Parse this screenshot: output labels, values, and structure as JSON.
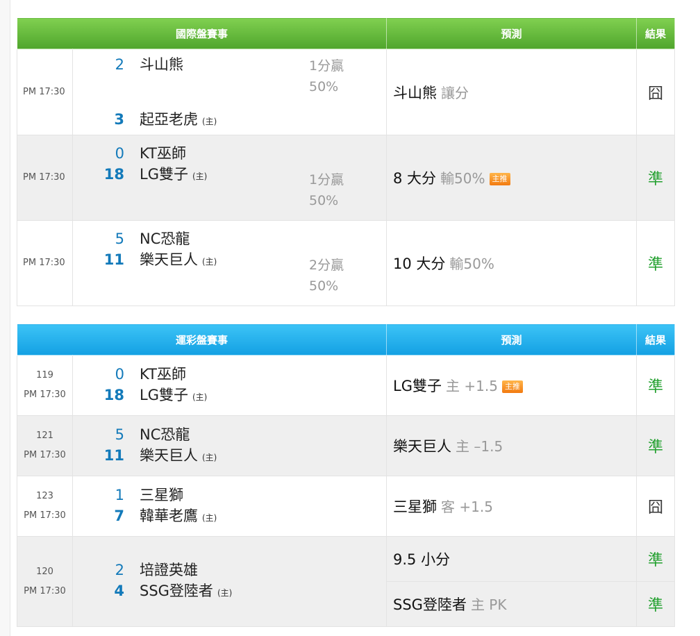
{
  "intl": {
    "headers": {
      "event": "國際盤賽事",
      "predict": "預測",
      "result": "結果"
    },
    "rows": [
      {
        "time": "PM 17:30",
        "away_score": "2",
        "away_team": "斗山熊",
        "home_score": "3",
        "home_team": "起亞老虎",
        "home_tag": "(主)",
        "odds_1": "1分贏",
        "odds_2": "50%",
        "pick": "斗山熊",
        "pick_detail": "讓分",
        "badge": "",
        "result": "囧"
      },
      {
        "time": "PM 17:30",
        "away_score": "0",
        "away_team": "KT巫師",
        "home_score": "18",
        "home_team": "LG雙子",
        "home_tag": "(主)",
        "odds_1": "1分贏",
        "odds_2": "50%",
        "pick": "8 大分",
        "pick_detail": "輸50%",
        "badge": "主推",
        "result": "準"
      },
      {
        "time": "PM 17:30",
        "away_score": "5",
        "away_team": "NC恐龍",
        "home_score": "11",
        "home_team": "樂天巨人",
        "home_tag": "(主)",
        "odds_1": "2分贏",
        "odds_2": "50%",
        "pick": "10 大分",
        "pick_detail": "輸50%",
        "badge": "",
        "result": "準"
      }
    ]
  },
  "lottery": {
    "headers": {
      "event": "運彩盤賽事",
      "predict": "預測",
      "result": "結果"
    },
    "rows": [
      {
        "num": "119",
        "time": "PM 17:30",
        "away_score": "0",
        "away_team": "KT巫師",
        "home_score": "18",
        "home_team": "LG雙子",
        "home_tag": "(主)",
        "pick": "LG雙子",
        "pick_detail": "主 +1.5",
        "badge": "主推",
        "result": "準"
      },
      {
        "num": "121",
        "time": "PM 17:30",
        "away_score": "5",
        "away_team": "NC恐龍",
        "home_score": "11",
        "home_team": "樂天巨人",
        "home_tag": "(主)",
        "pick": "樂天巨人",
        "pick_detail": "主 –1.5",
        "badge": "",
        "result": "準"
      },
      {
        "num": "123",
        "time": "PM 17:30",
        "away_score": "1",
        "away_team": "三星獅",
        "home_score": "7",
        "home_team": "韓華老鷹",
        "home_tag": "(主)",
        "pick": "三星獅",
        "pick_detail": "客 +1.5",
        "badge": "",
        "result": "囧"
      },
      {
        "num": "120",
        "time": "PM 17:30",
        "away_score": "2",
        "away_team": "培證英雄",
        "home_score": "4",
        "home_team": "SSG登陸者",
        "home_tag": "(主)",
        "pick_a": "9.5 小分",
        "result_a": "準",
        "pick_b": "SSG登陸者",
        "pick_b_detail": "主 PK",
        "result_b": "準"
      }
    ]
  },
  "colors": {
    "intl_header": "#5cb133",
    "lottery_header": "#1aa6e6",
    "score": "#137aba",
    "hit": "#23a02f",
    "badge": "#f38a1d"
  }
}
